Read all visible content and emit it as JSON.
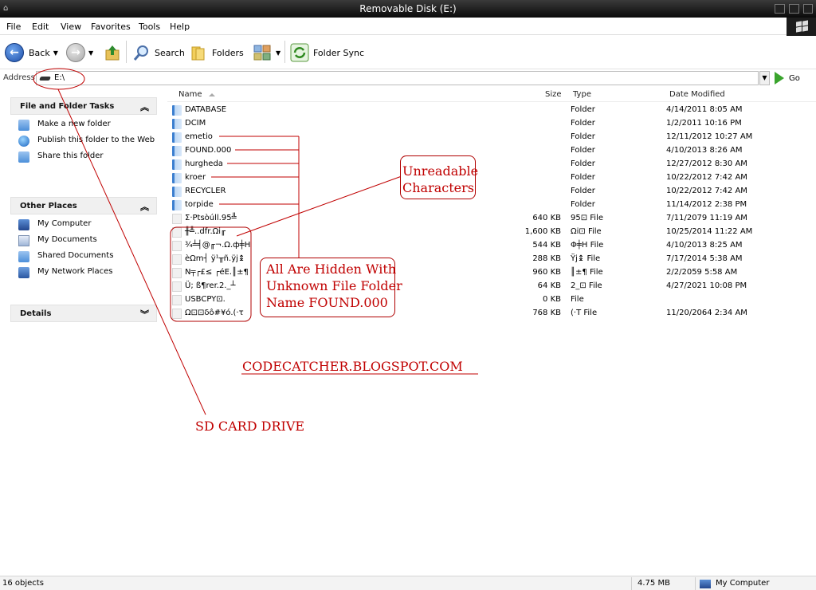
{
  "window": {
    "title": "Removable Disk (E:)"
  },
  "menu": [
    "File",
    "Edit",
    "View",
    "Favorites",
    "Tools",
    "Help"
  ],
  "toolbar": {
    "back": "Back",
    "search": "Search",
    "folders": "Folders",
    "sync": "Folder Sync"
  },
  "address": {
    "label": "Address",
    "value": "E:\\",
    "go": "Go"
  },
  "sidebar": {
    "tasks": {
      "title": "File and Folder Tasks",
      "items": [
        "Make a new folder",
        "Publish this folder to the Web",
        "Share this folder"
      ]
    },
    "places": {
      "title": "Other Places",
      "items": [
        "My Computer",
        "My Documents",
        "Shared Documents",
        "My Network Places"
      ]
    },
    "details": {
      "title": "Details"
    }
  },
  "columns": {
    "name": "Name",
    "size": "Size",
    "type": "Type",
    "date": "Date Modified"
  },
  "rows": [
    {
      "name": "DATABASE",
      "size": "",
      "type": "Folder",
      "date": "4/14/2011 8:05 AM",
      "kind": "folder"
    },
    {
      "name": "DCIM",
      "size": "",
      "type": "Folder",
      "date": "1/2/2011 10:16 PM",
      "kind": "folder"
    },
    {
      "name": "emetio",
      "size": "",
      "type": "Folder",
      "date": "12/11/2012 10:27 AM",
      "kind": "folder"
    },
    {
      "name": "FOUND.000",
      "size": "",
      "type": "Folder",
      "date": "4/10/2013 8:26 AM",
      "kind": "folder"
    },
    {
      "name": "hurgheda",
      "size": "",
      "type": "Folder",
      "date": "12/27/2012 8:30 AM",
      "kind": "folder"
    },
    {
      "name": "kroer",
      "size": "",
      "type": "Folder",
      "date": "10/22/2012 7:42 AM",
      "kind": "folder"
    },
    {
      "name": "RECYCLER",
      "size": "",
      "type": "Folder",
      "date": "10/22/2012 7:42 AM",
      "kind": "folder"
    },
    {
      "name": "torpide",
      "size": "",
      "type": "Folder",
      "date": "11/14/2012 2:38 PM",
      "kind": "folder"
    },
    {
      "name": "Σ·Ptsòúll.95╩",
      "size": "640 KB",
      "type": "95⊡ File",
      "date": "7/11/2079 11:19 AM",
      "kind": "file"
    },
    {
      "name": "╫╩..dfr.Ωi╓",
      "size": "1,600 KB",
      "type": "Ωi⊡ File",
      "date": "10/25/2014 11:22 AM",
      "kind": "file"
    },
    {
      "name": "¾╧╡@╓¬.Ω.ф╪H",
      "size": "544 KB",
      "type": "Φ╪H File",
      "date": "4/10/2013 8:25 AM",
      "kind": "file"
    },
    {
      "name": "èΩm┤ ÿ¹╥ñ.ÿj↨",
      "size": "288 KB",
      "type": "Ÿj↨ File",
      "date": "7/17/2014 5:38 AM",
      "kind": "file"
    },
    {
      "name": "N╤┌£≤ ┌éE.║±¶",
      "size": "960 KB",
      "type": "║±¶ File",
      "date": "2/2/2059 5:58 AM",
      "kind": "file"
    },
    {
      "name": "Ü; ß¶rer.2._┴",
      "size": "64 KB",
      "type": "2_⊡ File",
      "date": "4/27/2021 10:08 PM",
      "kind": "file"
    },
    {
      "name": "USBCPY⊡.",
      "size": "0 KB",
      "type": "File",
      "date": "",
      "kind": "file"
    },
    {
      "name": "Ω⊡⊡δô#¥ó.(·τ",
      "size": "768 KB",
      "type": "(·T File",
      "date": "11/20/2064 2:34 AM",
      "kind": "file"
    }
  ],
  "annotations": {
    "unreadable": [
      "Unreadable",
      "Characters"
    ],
    "hidden": [
      "All Are Hidden With",
      "Unknown File Folder",
      "Name FOUND.000"
    ],
    "blog": "CODECATCHER.BLOGSPOT.COM",
    "sdcard": "SD CARD DRIVE"
  },
  "status": {
    "objects": "16 objects",
    "size": "4.75 MB",
    "location": "My Computer"
  },
  "colors": {
    "annotation": "#c00000",
    "titlebar": "#1a1a1a"
  }
}
